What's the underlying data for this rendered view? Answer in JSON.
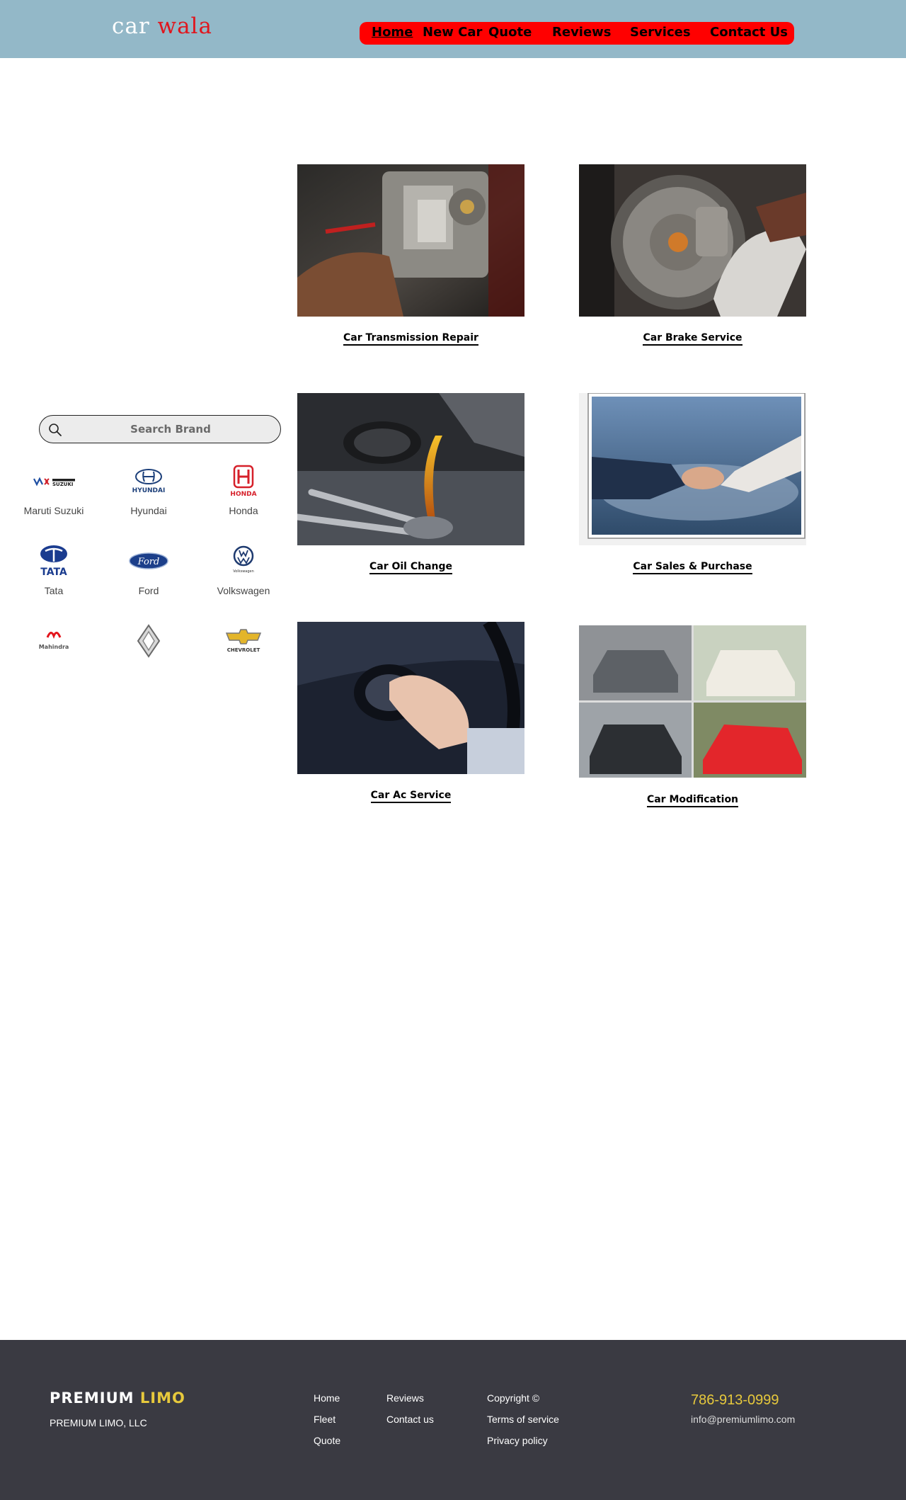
{
  "header": {
    "logo_part1": "car",
    "logo_part2": "wala",
    "logo_colors": {
      "part1": "#ffffff",
      "part2": "#e0161e"
    },
    "background": "#93b8c8",
    "nav_background": "#ff0000",
    "nav": [
      {
        "label": "Home",
        "active": true
      },
      {
        "label": "New Car",
        "active": false
      },
      {
        "label": "Quote",
        "active": false
      },
      {
        "label": "Reviews",
        "active": false
      },
      {
        "label": "Services",
        "active": false
      },
      {
        "label": "Contact Us",
        "active": false
      }
    ]
  },
  "search": {
    "placeholder": "Search Brand",
    "icon": "search-icon"
  },
  "brands": [
    {
      "name": "Maruti Suzuki",
      "logo": "maruti-suzuki-logo",
      "logo_text": "SUZUKI"
    },
    {
      "name": "Hyundai",
      "logo": "hyundai-logo",
      "logo_text": "HYUNDAI"
    },
    {
      "name": "Honda",
      "logo": "honda-logo",
      "logo_text": "HONDA"
    },
    {
      "name": "Tata",
      "logo": "tata-logo",
      "logo_text": "TATA"
    },
    {
      "name": "Ford",
      "logo": "ford-logo",
      "logo_text": "Ford"
    },
    {
      "name": "Volkswagen",
      "logo": "volkswagen-logo",
      "logo_text": "Volkswagen"
    },
    {
      "name": "",
      "logo": "mahindra-logo",
      "logo_text": "Mahindra"
    },
    {
      "name": "",
      "logo": "renault-logo",
      "logo_text": ""
    },
    {
      "name": "",
      "logo": "chevrolet-logo",
      "logo_text": "CHEVROLET"
    }
  ],
  "services": [
    {
      "title": "Car Transmission Repair",
      "image": "transmission-repair-photo"
    },
    {
      "title": "Car Brake Service",
      "image": "brake-service-photo"
    },
    {
      "title": "Car Oil Change",
      "image": "oil-change-photo"
    },
    {
      "title": "Car Sales & Purchase",
      "image": "sales-handshake-photo"
    },
    {
      "title": "Car Ac Service",
      "image": "ac-vent-photo"
    },
    {
      "title": "Car Modification",
      "image": "modified-cars-collage-photo"
    }
  ],
  "footer": {
    "brand_part1": "PREMIUM",
    "brand_part2": "LIMO",
    "brand_accent": "#e7c93c",
    "company": "PREMIUM LIMO, LLC",
    "links_col1": [
      "Home",
      "Fleet",
      "Quote"
    ],
    "links_col2": [
      "Reviews",
      "Contact us"
    ],
    "links_col3": [
      "Copyright ©",
      "Terms of service",
      "Privacy policy"
    ],
    "phone": "786-913-0999",
    "email": "info@premiumlimo.com",
    "background": "#3a3a42"
  }
}
